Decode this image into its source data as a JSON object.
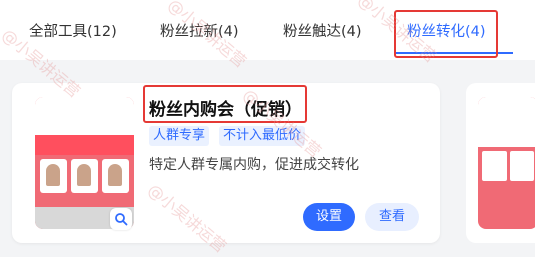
{
  "tabs": [
    {
      "label": "全部工具(12)",
      "active": false
    },
    {
      "label": "粉丝拉新(4)",
      "active": false
    },
    {
      "label": "粉丝触达(4)",
      "active": false
    },
    {
      "label": "粉丝转化(4)",
      "active": true
    }
  ],
  "card": {
    "title": "粉丝内购会（促销）",
    "tags": [
      "人群专享",
      "不计入最低价"
    ],
    "description": "特定人群专属内购，促进成交转化",
    "primary_button": "设置",
    "secondary_button": "查看"
  },
  "watermark": "@小吴讲运营",
  "colors": {
    "accent": "#2f6bff",
    "highlight": "#e53935"
  }
}
